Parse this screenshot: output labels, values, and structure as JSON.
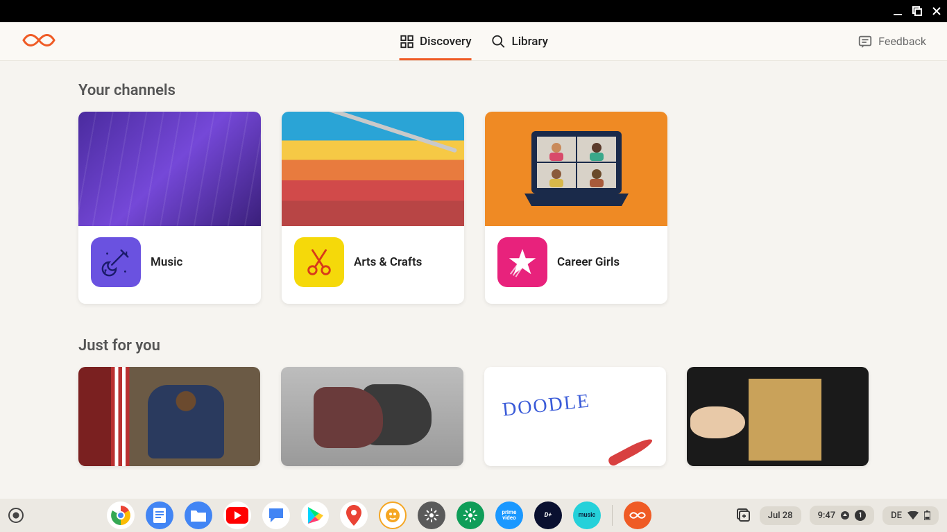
{
  "nav": {
    "discovery": "Discovery",
    "library": "Library",
    "feedback": "Feedback"
  },
  "sections": {
    "your_channels": "Your channels",
    "just_for_you": "Just for you"
  },
  "channels": [
    {
      "label": "Music",
      "icon_bg": "#6a52e0",
      "icon_name": "guitar-icon"
    },
    {
      "label": "Arts & Crafts",
      "icon_bg": "#f5d90a",
      "icon_name": "scissors-icon"
    },
    {
      "label": "Career Girls",
      "icon_bg": "#e8227c",
      "icon_name": "star-icon"
    }
  ],
  "taskbar": {
    "date": "Jul 28",
    "time": "9:47",
    "notifications": "1",
    "lang": "DE"
  },
  "colors": {
    "accent": "#ef5b25"
  }
}
